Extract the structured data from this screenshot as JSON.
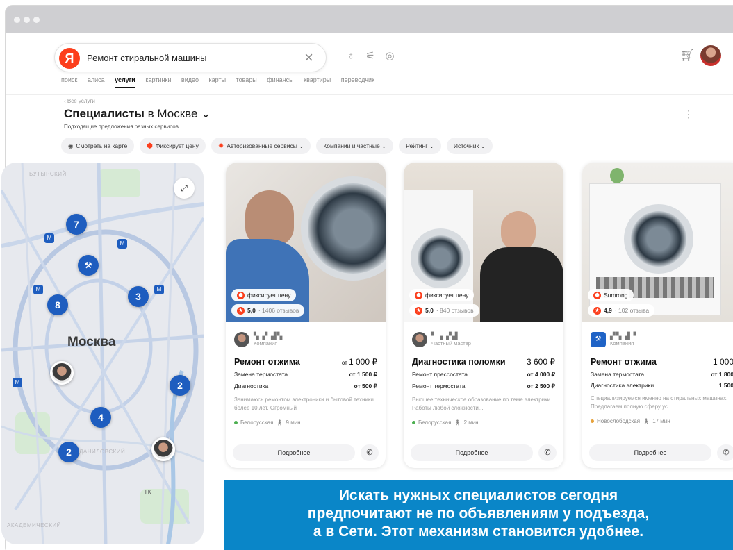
{
  "search": {
    "logo": "Я",
    "query": "Ремонт стиральной машины"
  },
  "tabs": [
    "поиск",
    "алиса",
    "услуги",
    "картинки",
    "видео",
    "карты",
    "товары",
    "финансы",
    "квартиры",
    "переводчик"
  ],
  "services": {
    "breadcrumb": "‹ Все услуги",
    "title_bold": "Специалисты",
    "title_rest": " в Москве ⌄",
    "subtitle": "Подходящие предложения разных сервисов",
    "filters": [
      "Смотреть на карте",
      "Фиксирует цену",
      "Авторизованные сервисы ⌄",
      "Компании и частные ⌄",
      "Рейтинг ⌄",
      "Источник ⌄"
    ]
  },
  "map": {
    "city_label": "Москва",
    "districts": [
      "БУТЫРСКИЙ",
      "ДАНИЛОВСКИЙ",
      "АКАДЕМИЧЕСКИЙ",
      "ТТК"
    ],
    "pins": [
      "7",
      "8",
      "3",
      "2",
      "4",
      "2"
    ]
  },
  "cards": [
    {
      "badge": "фиксирует цену",
      "rating": "5,0",
      "reviews": "· 1406 отзывов",
      "owner_type": "Компания",
      "service": "Ремонт отжима",
      "price_prefix": "от ",
      "price": "1 000 ₽",
      "lines": [
        {
          "name": "Замена термостата",
          "price": "от 1 500 ₽"
        },
        {
          "name": "Диагностика",
          "price": "от 500 ₽"
        }
      ],
      "description": "Занимаюсь ремонтом электроники и бытовой техники более 10 лет. Огромный",
      "station": "Белорусская",
      "walk": "9 мин",
      "more": "Подробнее"
    },
    {
      "badge": "фиксирует цену",
      "rating": "5,0",
      "reviews": "· 840 отзывов",
      "owner_type": "Частный мастер",
      "service": "Диагностика поломки",
      "price_prefix": "",
      "price": "3 600 ₽",
      "lines": [
        {
          "name": "Ремонт прессостата",
          "price": "от 4 000 ₽"
        },
        {
          "name": "Ремонт термостата",
          "price": "от 2 500 ₽"
        }
      ],
      "description": "Высшее техническое образование по теме электрики. Работы любой сложности...",
      "station": "Белорусская",
      "walk": "2 мин",
      "more": "Подробнее"
    },
    {
      "badge": "Sumrong",
      "rating": "4,9",
      "reviews": "· 102 отзыва",
      "owner_type": "Компания",
      "service": "Ремонт отжима",
      "price_prefix": "",
      "price": "1 000",
      "lines": [
        {
          "name": "Замена термостата",
          "price": "от 1 800"
        },
        {
          "name": "Диагностика электрики",
          "price": "1 500"
        }
      ],
      "description": "Специализируемся именно на стиральных машинах. Предлагаем полную сферу ус...",
      "station": "Новослободская",
      "walk": "17 мин",
      "more": "Подробнее"
    }
  ],
  "caption": {
    "line1": "Искать нужных специалистов сегодня",
    "line2": "предпочитают не по объявлениям у подъезда,",
    "line3": "а в Сети. Этот механизм становится удобнее."
  }
}
